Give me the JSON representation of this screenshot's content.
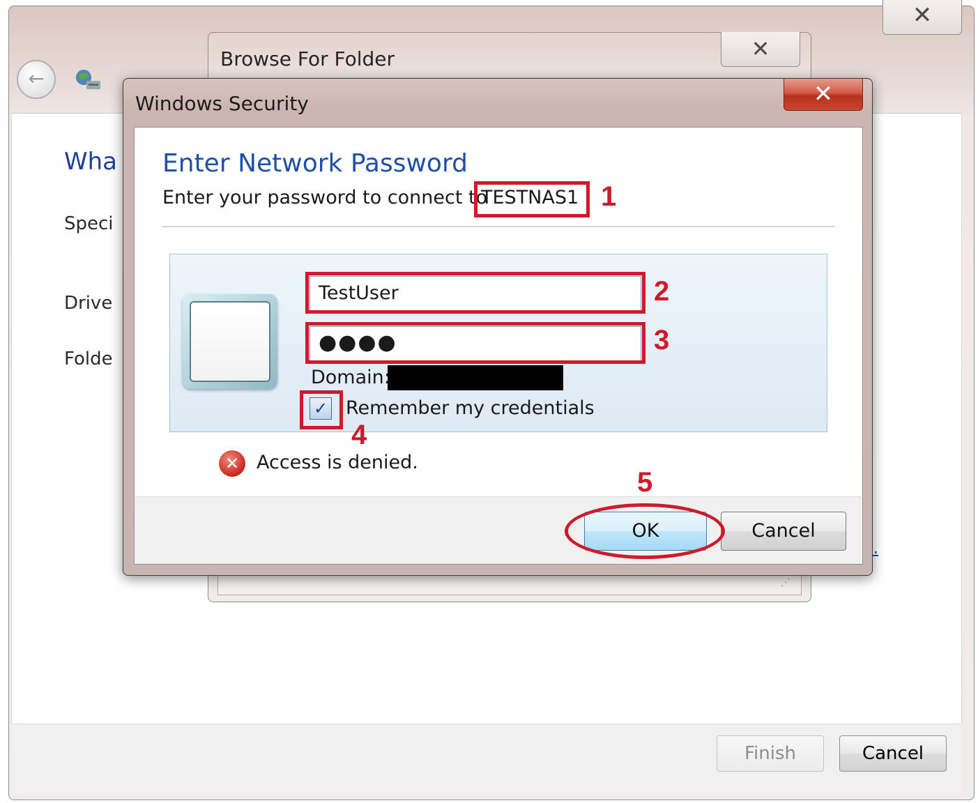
{
  "wizard": {
    "close_glyph": "✕",
    "back_glyph": "←",
    "heading_partial": "Wha",
    "specify_partial": "Speci",
    "drive_partial": "Drive",
    "folder_partial": "Folde",
    "link_partial": "s.",
    "finish_label": "Finish",
    "cancel_label": "Cancel"
  },
  "browse": {
    "title": "Browse For Folder",
    "close_glyph": "✕",
    "grip": "⋰"
  },
  "security": {
    "title": "Windows Security",
    "close_glyph": "✕",
    "heading": "Enter Network Password",
    "instruction": "Enter your password to connect to",
    "server": "TESTNAS1",
    "username": "TestUser",
    "password_mask": "●●●●",
    "domain_label": "Domain:",
    "remember_label": "Remember my credentials",
    "checkbox_glyph": "✓",
    "error_glyph": "✕",
    "error_text": "Access is denied.",
    "ok_label": "OK",
    "cancel_label": "Cancel"
  },
  "annotations": [
    "1",
    "2",
    "3",
    "4",
    "5"
  ],
  "colors": {
    "annotation": "#d0192b",
    "heading": "#1f4fa8",
    "close_red": "#c8462f"
  },
  "icons": [
    "back-arrow-icon",
    "network-drive-icon",
    "close-icon",
    "user-tile-icon",
    "checkbox-check-icon",
    "error-icon"
  ]
}
